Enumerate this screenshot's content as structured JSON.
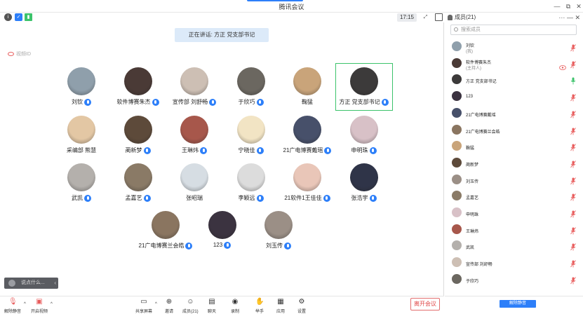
{
  "window": {
    "title": "腾讯会议",
    "controls": [
      "—",
      "⧉",
      "✕"
    ]
  },
  "topbar": {
    "time": "17:15"
  },
  "stage": {
    "speaking_banner": "正在讲话: 方正  党支部书记",
    "local_tag": "视频ID"
  },
  "tiles": [
    {
      "name": "刘钦",
      "color": "#8f9fab",
      "mic": true
    },
    {
      "name": "软件博赛朱杰",
      "color": "#4a3a36",
      "mic": true
    },
    {
      "name": "宣传部 刘舒畅",
      "color": "#cdbfb4",
      "mic": true
    },
    {
      "name": "于欣巧",
      "color": "#6b6760",
      "mic": true
    },
    {
      "name": "鞠猛",
      "color": "#c9a47a",
      "mic": false
    },
    {
      "name": "方正  党支部书记",
      "color": "#3c3a3a",
      "mic": true,
      "active": true
    },
    {
      "name": "采编部 熊慧",
      "color": "#e3c7a4",
      "mic": false
    },
    {
      "name": "蔺新梦",
      "color": "#5d4a3a",
      "mic": true
    },
    {
      "name": "王琳炜",
      "color": "#a7574b",
      "mic": true
    },
    {
      "name": "宁晓佳",
      "color": "#f2e4c4",
      "mic": true
    },
    {
      "name": "21广电博赛戴瑶",
      "color": "#47506a",
      "mic": true
    },
    {
      "name": "申明珠",
      "color": "#d8c1c7",
      "mic": true
    },
    {
      "name": "武凯",
      "color": "#b4b0ac",
      "mic": true
    },
    {
      "name": "孟嘉艺",
      "color": "#8a7a66",
      "mic": true
    },
    {
      "name": "张昭瑞",
      "color": "#d6dde3",
      "mic": false
    },
    {
      "name": "李颖远",
      "color": "#dcdcdc",
      "mic": true
    },
    {
      "name": "21软件1王佳佳",
      "color": "#e9c6b8",
      "mic": true
    },
    {
      "name": "张浩宇",
      "color": "#2f3448",
      "mic": true
    },
    {
      "name": "21广电博赛兰会皓",
      "color": "#8a7560",
      "mic": true
    },
    {
      "name": "123",
      "color": "#3b3340",
      "mic": true
    },
    {
      "name": "刘玉传",
      "color": "#9b8f86",
      "mic": true
    }
  ],
  "chat": {
    "placeholder": "说点什么...",
    "arrow": "‹"
  },
  "toolbar": {
    "unmute": "解除静音",
    "video": "开启视频",
    "share": "共享屏幕",
    "invite": "邀请",
    "members": "成员(21)",
    "chat": "聊天",
    "record": "录制",
    "raise_hand": "举手",
    "apps": "应用",
    "settings": "设置",
    "leave": "离开会议"
  },
  "panel": {
    "title": "成员(21)",
    "ctrl_more": "···",
    "ctrl_min": "—",
    "ctrl_close": "✕",
    "search_placeholder": "搜索成员",
    "unmute_all": "解除静音",
    "members": [
      {
        "name": "刘钦",
        "sub": "(我)",
        "color": "#8f9fab",
        "mic_on": false,
        "video": false
      },
      {
        "name": "软件博赛朱杰",
        "sub": "(主持人)",
        "color": "#4a3a36",
        "mic_on": false,
        "video": true
      },
      {
        "name": "方正  党支部书记",
        "sub": "",
        "color": "#3c3a3a",
        "mic_on": true,
        "video": false
      },
      {
        "name": "123",
        "sub": "",
        "color": "#3b3340",
        "mic_on": false,
        "video": false
      },
      {
        "name": "21广电博赛戴瑶",
        "sub": "",
        "color": "#47506a",
        "mic_on": false,
        "video": false
      },
      {
        "name": "21广电博赛兰会皓",
        "sub": "",
        "color": "#8a7560",
        "mic_on": false,
        "video": false
      },
      {
        "name": "鞠猛",
        "sub": "",
        "color": "#c9a47a",
        "mic_on": false,
        "video": false
      },
      {
        "name": "蔺新梦",
        "sub": "",
        "color": "#5d4a3a",
        "mic_on": false,
        "video": false
      },
      {
        "name": "刘玉传",
        "sub": "",
        "color": "#9b8f86",
        "mic_on": false,
        "video": false
      },
      {
        "name": "孟嘉艺",
        "sub": "",
        "color": "#8a7a66",
        "mic_on": false,
        "video": false
      },
      {
        "name": "申明珠",
        "sub": "",
        "color": "#d8c1c7",
        "mic_on": false,
        "video": false
      },
      {
        "name": "王琳炜",
        "sub": "",
        "color": "#a7574b",
        "mic_on": false,
        "video": false
      },
      {
        "name": "武凯",
        "sub": "",
        "color": "#b4b0ac",
        "mic_on": false,
        "video": false
      },
      {
        "name": "宣传部 刘舒畅",
        "sub": "",
        "color": "#cdbfb4",
        "mic_on": false,
        "video": false
      },
      {
        "name": "于欣巧",
        "sub": "",
        "color": "#6b6760",
        "mic_on": false,
        "video": false
      }
    ]
  },
  "colors": {
    "accent": "#2d7ff9",
    "active_border": "#3cc36b",
    "leave": "#e04848",
    "muted_mic": "#e85c5c",
    "live_mic": "#3cc36b"
  }
}
